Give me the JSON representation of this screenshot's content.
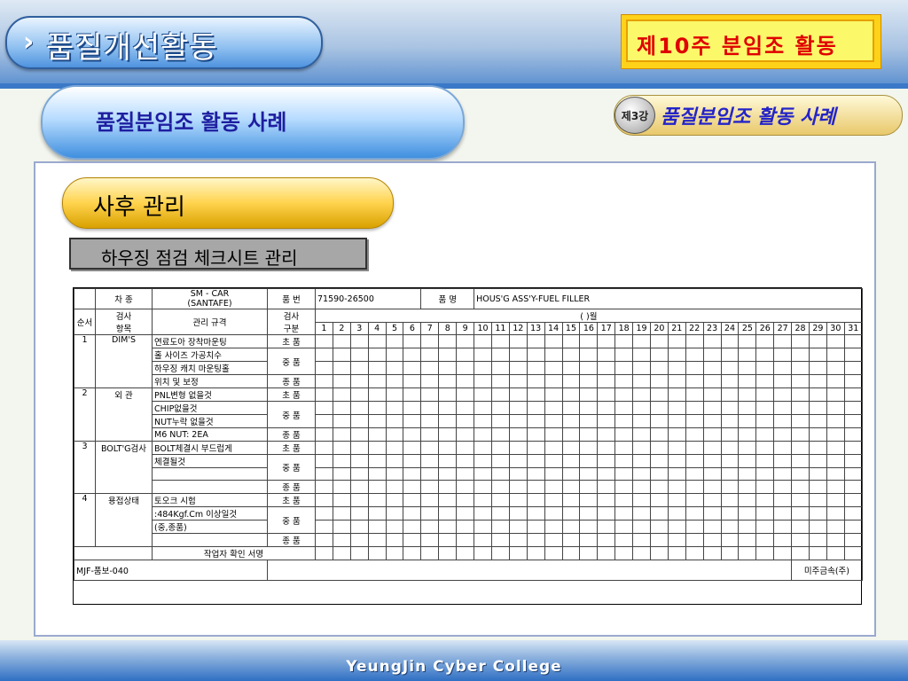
{
  "header": {
    "title": "품질개선활동",
    "week_label": "제10주  분임조  활동"
  },
  "subtitle": "품질분임조 활동 사례",
  "lecture": {
    "badge": "제3강",
    "title": "품질분임조 활동 사례"
  },
  "section": {
    "title": "사후 관리",
    "box": "하우징 점검 체크시트 관리"
  },
  "sheet": {
    "car_label": "차  종",
    "car_value_1": "SM - CAR",
    "car_value_2": "(SANTAFE)",
    "part_no_label": "품  번",
    "part_no_value": "71590-26500",
    "part_name_label": "품  명",
    "part_name_value": "HOUS'G ASS'Y-FUEL FILLER",
    "col_seq": "순서",
    "col_item": "검사\n항목",
    "col_spec": "관리 규격",
    "col_type": "검사\n구분",
    "month": "(      )월",
    "days": [
      "1",
      "2",
      "3",
      "4",
      "5",
      "6",
      "7",
      "8",
      "9",
      "10",
      "11",
      "12",
      "13",
      "14",
      "15",
      "16",
      "17",
      "18",
      "19",
      "20",
      "21",
      "22",
      "23",
      "24",
      "25",
      "26",
      "27",
      "28",
      "29",
      "30",
      "31"
    ],
    "rows": [
      {
        "seq": "1",
        "item": "DIM'S",
        "specs": [
          "연료도아 장착마운팅",
          "홀 사이즈 가공치수",
          "하우징 캐치 마운팅홀",
          "위치 및 보정"
        ],
        "types": [
          "초 품",
          "중 품",
          "종 품"
        ]
      },
      {
        "seq": "2",
        "item": "외 관",
        "specs": [
          "PNL변형 없을것",
          "CHIP없을것",
          "NUT누락 없을것",
          "M6 NUT: 2EA"
        ],
        "types": [
          "초 품",
          "중 품",
          "종 품"
        ]
      },
      {
        "seq": "3",
        "item": "BOLT'G검사",
        "specs": [
          "BOLT체결시 부드럽게",
          "체결될것"
        ],
        "types": [
          "초 품",
          "중 품",
          "종 품"
        ]
      },
      {
        "seq": "4",
        "item": "용접상태",
        "specs": [
          "토오크 시험",
          ":484Kgf.Cm 이상일것",
          "(중,종품)"
        ],
        "types": [
          "초 품",
          "중 품",
          "종 품"
        ]
      }
    ],
    "sign_label": "작업자 확인 서명",
    "form_no": "MJF-품보-040",
    "company": "미주금속(주)"
  },
  "footer": "YeungJin Cyber College"
}
